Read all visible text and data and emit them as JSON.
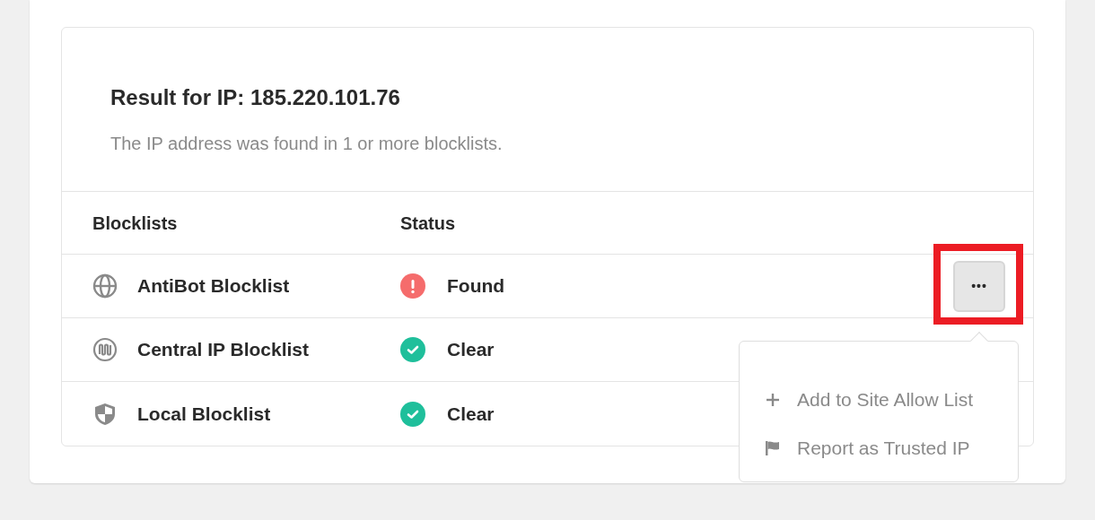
{
  "result": {
    "title": "Result for IP: 185.220.101.76",
    "description": "The IP address was found in 1 or more blocklists."
  },
  "table": {
    "columns": [
      "Blocklists",
      "Status"
    ],
    "rows": [
      {
        "kind": "globe",
        "name": "AntiBot Blocklist",
        "status": {
          "kind": "found",
          "text": "Found"
        },
        "menu_button": {
          "label": "•••",
          "highlighted": true
        }
      },
      {
        "kind": "signal",
        "name": "Central IP Blocklist",
        "status": {
          "kind": "clear",
          "text": "Clear"
        }
      },
      {
        "kind": "shield",
        "name": "Local Blocklist",
        "status": {
          "kind": "clear",
          "text": "Clear"
        }
      }
    ]
  },
  "menu": {
    "items": [
      {
        "kind": "plus",
        "label": "Add to Site Allow List"
      },
      {
        "kind": "flag",
        "label": "Report as Trusted IP"
      }
    ]
  }
}
